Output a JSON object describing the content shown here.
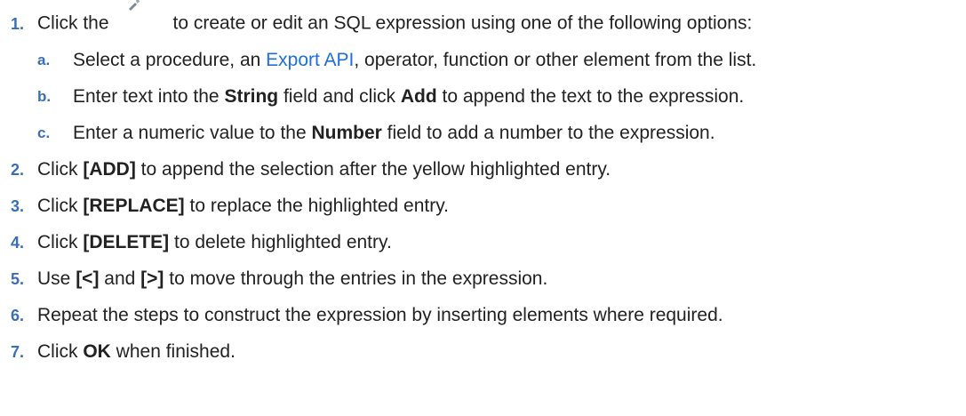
{
  "steps": [
    {
      "num": "1.",
      "pre": "Click the",
      "post": "to create or edit an SQL expression using one of the following options:",
      "icon": "expression-editor-icon",
      "substeps": [
        {
          "num": "a.",
          "t1": "Select a procedure, an ",
          "link": "Export API",
          "t2": ", operator, function or other element from the list."
        },
        {
          "num": "b.",
          "t1": "Enter text into the ",
          "b1": "String",
          "t2": " field and click ",
          "b2": "Add",
          "t3": " to append the text to the expression."
        },
        {
          "num": "c.",
          "t1": "Enter a numeric value to the ",
          "b1": "Number",
          "t2": " field to add a number to the expression."
        }
      ]
    },
    {
      "num": "2.",
      "t1": "Click ",
      "b1": "[ADD]",
      "t2": " to append the selection after the yellow highlighted entry."
    },
    {
      "num": "3.",
      "t1": "Click ",
      "b1": "[REPLACE]",
      "t2": " to replace the highlighted entry."
    },
    {
      "num": "4.",
      "t1": "Click ",
      "b1": "[DELETE]",
      "t2": " to delete highlighted entry."
    },
    {
      "num": "5.",
      "t1": "Use ",
      "b1": "[<]",
      "t2": " and ",
      "b2": "[>]",
      "t3": " to move through the entries in the expression."
    },
    {
      "num": "6.",
      "t1": "Repeat the steps to construct the expression by inserting elements where required."
    },
    {
      "num": "7.",
      "t1": "Click ",
      "b1": "OK",
      "t2": " when finished."
    }
  ]
}
